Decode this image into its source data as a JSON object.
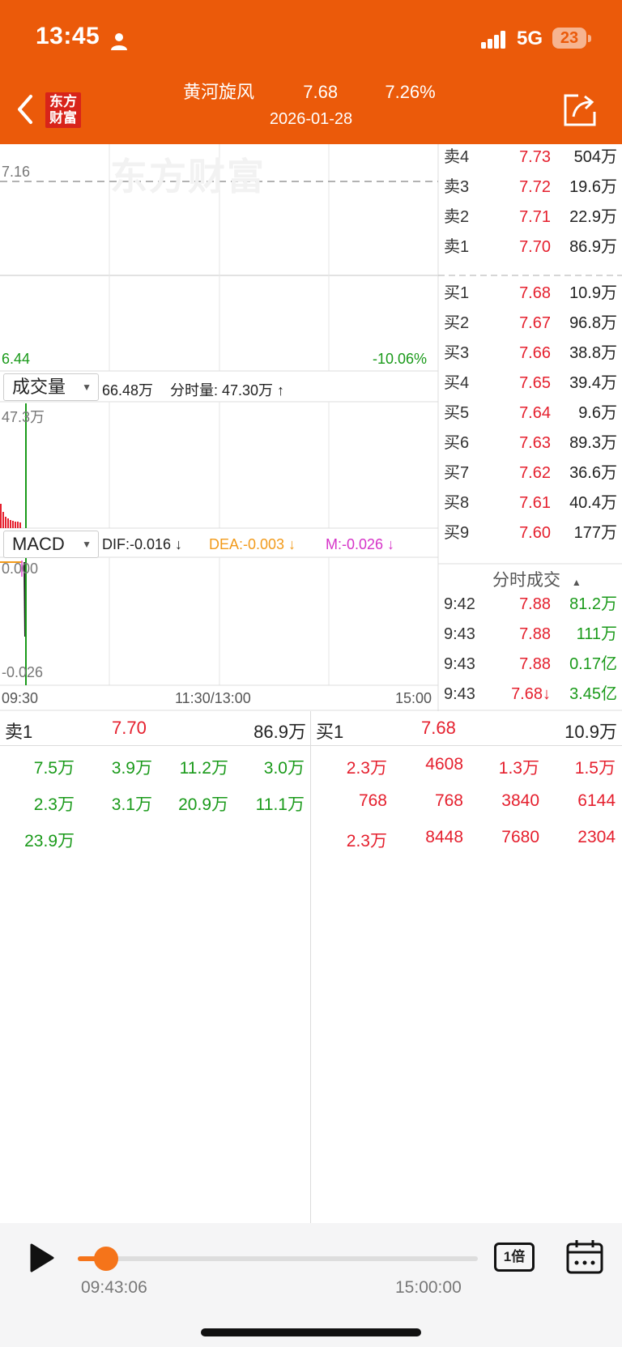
{
  "status_bar": {
    "time": "13:45",
    "network": "5G",
    "battery": "23"
  },
  "header": {
    "stock_name": "黄河旋风",
    "price": "7.68",
    "change_pct": "7.26%",
    "date": "2026-01-28",
    "logo_text_1": "东方",
    "logo_text_2": "财富"
  },
  "watermark": "东方财富",
  "chart": {
    "ref_price": "7.16",
    "low_price": "6.44",
    "low_pct": "-10.06%",
    "vol_selector": "成交量",
    "vol_total": "66.48万",
    "vol_tick_label": "分时量: 47.30万 ↑",
    "vol_max": "47.3万",
    "macd_selector": "MACD",
    "dif": "DIF:-0.016 ↓",
    "dea": "DEA:-0.003 ↓",
    "m": "M:-0.026 ↓",
    "macd_top": "0.000",
    "macd_bottom": "-0.026",
    "time_start": "09:30",
    "time_mid": "11:30/13:00",
    "time_end": "15:00"
  },
  "order_book": {
    "asks": [
      {
        "label": "卖4",
        "price": "7.73",
        "vol": "504万"
      },
      {
        "label": "卖3",
        "price": "7.72",
        "vol": "19.6万"
      },
      {
        "label": "卖2",
        "price": "7.71",
        "vol": "22.9万"
      },
      {
        "label": "卖1",
        "price": "7.70",
        "vol": "86.9万"
      }
    ],
    "bids": [
      {
        "label": "买1",
        "price": "7.68",
        "vol": "10.9万"
      },
      {
        "label": "买2",
        "price": "7.67",
        "vol": "96.8万"
      },
      {
        "label": "买3",
        "price": "7.66",
        "vol": "38.8万"
      },
      {
        "label": "买4",
        "price": "7.65",
        "vol": "39.4万"
      },
      {
        "label": "买5",
        "price": "7.64",
        "vol": "9.6万"
      },
      {
        "label": "买6",
        "price": "7.63",
        "vol": "89.3万"
      },
      {
        "label": "买7",
        "price": "7.62",
        "vol": "36.6万"
      },
      {
        "label": "买8",
        "price": "7.61",
        "vol": "40.4万"
      },
      {
        "label": "买9",
        "price": "7.60",
        "vol": "177万"
      }
    ]
  },
  "ticks": {
    "title": "分时成交",
    "rows": [
      {
        "time": "9:42",
        "price": "7.88",
        "vol": "81.2万"
      },
      {
        "time": "9:43",
        "price": "7.88",
        "vol": "111万"
      },
      {
        "time": "9:43",
        "price": "7.88",
        "vol": "0.17亿"
      },
      {
        "time": "9:43",
        "price": "7.68↓",
        "vol": "3.45亿"
      }
    ]
  },
  "queue": {
    "sell_label": "卖1",
    "sell_price": "7.70",
    "sell_vol": "86.9万",
    "buy_label": "买1",
    "buy_price": "7.68",
    "buy_vol": "10.9万",
    "sell_orders": [
      [
        "7.5万",
        "3.9万",
        "11.2万",
        "3.0万"
      ],
      [
        "2.3万",
        "3.1万",
        "20.9万",
        "11.1万"
      ],
      [
        "23.9万",
        "",
        "",
        ""
      ]
    ],
    "buy_orders": [
      [
        "2.3万",
        "4608",
        "1.3万",
        "1.5万"
      ],
      [
        "768",
        "768",
        "3840",
        "6144"
      ],
      [
        "2.3万",
        "8448",
        "7680",
        "2304"
      ]
    ]
  },
  "player": {
    "current_time": "09:43:06",
    "end_time": "15:00:00",
    "speed": "1倍",
    "progress": 0.07
  }
}
